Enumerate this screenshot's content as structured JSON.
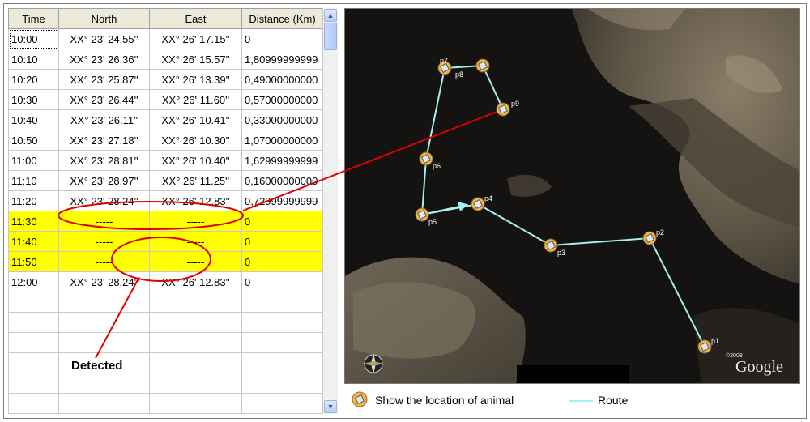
{
  "table": {
    "headers": [
      "Time",
      "North",
      "East",
      "Distance (Km)"
    ],
    "rows": [
      {
        "time": "10:00",
        "north": "XX° 23' 24.55''",
        "east": "XX° 26' 17.15''",
        "distance": "0",
        "highlight": false
      },
      {
        "time": "10:10",
        "north": "XX° 23' 26.36''",
        "east": "XX° 26' 15.57''",
        "distance": "1,80999999999",
        "highlight": false
      },
      {
        "time": "10:20",
        "north": "XX° 23' 25.87''",
        "east": "XX° 26' 13.39''",
        "distance": "0,49000000000",
        "highlight": false
      },
      {
        "time": "10:30",
        "north": "XX° 23' 26.44''",
        "east": "XX° 26' 11.60''",
        "distance": "0,57000000000",
        "highlight": false
      },
      {
        "time": "10:40",
        "north": "XX° 23' 26.11''",
        "east": "XX° 26' 10.41''",
        "distance": "0,33000000000",
        "highlight": false
      },
      {
        "time": "10:50",
        "north": "XX° 23' 27.18''",
        "east": "XX° 26' 10.30''",
        "distance": "1,07000000000",
        "highlight": false
      },
      {
        "time": "11:00",
        "north": "XX° 23' 28.81''",
        "east": "XX° 26' 10.40''",
        "distance": "1,62999999999",
        "highlight": false
      },
      {
        "time": "11:10",
        "north": "XX° 23' 28.97''",
        "east": "XX° 26' 11.25''",
        "distance": "0,16000000000",
        "highlight": false
      },
      {
        "time": "11:20",
        "north": "XX° 23' 28.24''",
        "east": "XX° 26' 12.83''",
        "distance": "0,72999999999",
        "highlight": false
      },
      {
        "time": "11:30",
        "north": "-----",
        "east": "-----",
        "distance": "0",
        "highlight": true
      },
      {
        "time": "11:40",
        "north": "-----",
        "east": "-----",
        "distance": "0",
        "highlight": true
      },
      {
        "time": "11:50",
        "north": "-----",
        "east": "-----",
        "distance": "0",
        "highlight": true
      },
      {
        "time": "12:00",
        "north": "XX° 23' 28.24''",
        "east": "XX° 26' 12.83''",
        "distance": "0",
        "highlight": false
      },
      {
        "time": "",
        "north": "",
        "east": "",
        "distance": "",
        "highlight": false
      },
      {
        "time": "",
        "north": "",
        "east": "",
        "distance": "",
        "highlight": false
      },
      {
        "time": "",
        "north": "",
        "east": "",
        "distance": "",
        "highlight": false
      },
      {
        "time": "",
        "north": "",
        "east": "",
        "distance": "",
        "highlight": false
      },
      {
        "time": "",
        "north": "",
        "east": "",
        "distance": "",
        "highlight": false
      },
      {
        "time": "",
        "north": "",
        "east": "",
        "distance": "",
        "highlight": false
      }
    ]
  },
  "scrollbar": {
    "up_icon": "triangle-up-icon",
    "down_icon": "triangle-down-icon"
  },
  "map": {
    "points": [
      "p1",
      "p2",
      "p3",
      "p4",
      "p5",
      "p6",
      "p7",
      "p8",
      "p9"
    ],
    "watermark": "Google",
    "copyright": "©2008",
    "route_color": "#a8f0f0",
    "marker_color": "#f2b54a"
  },
  "legend": {
    "marker_label": "Show the location of animal",
    "route_label": "Route",
    "marker_icon": "gps-collar-icon"
  },
  "annotation": {
    "label": "Detected",
    "color": "#e00000"
  }
}
